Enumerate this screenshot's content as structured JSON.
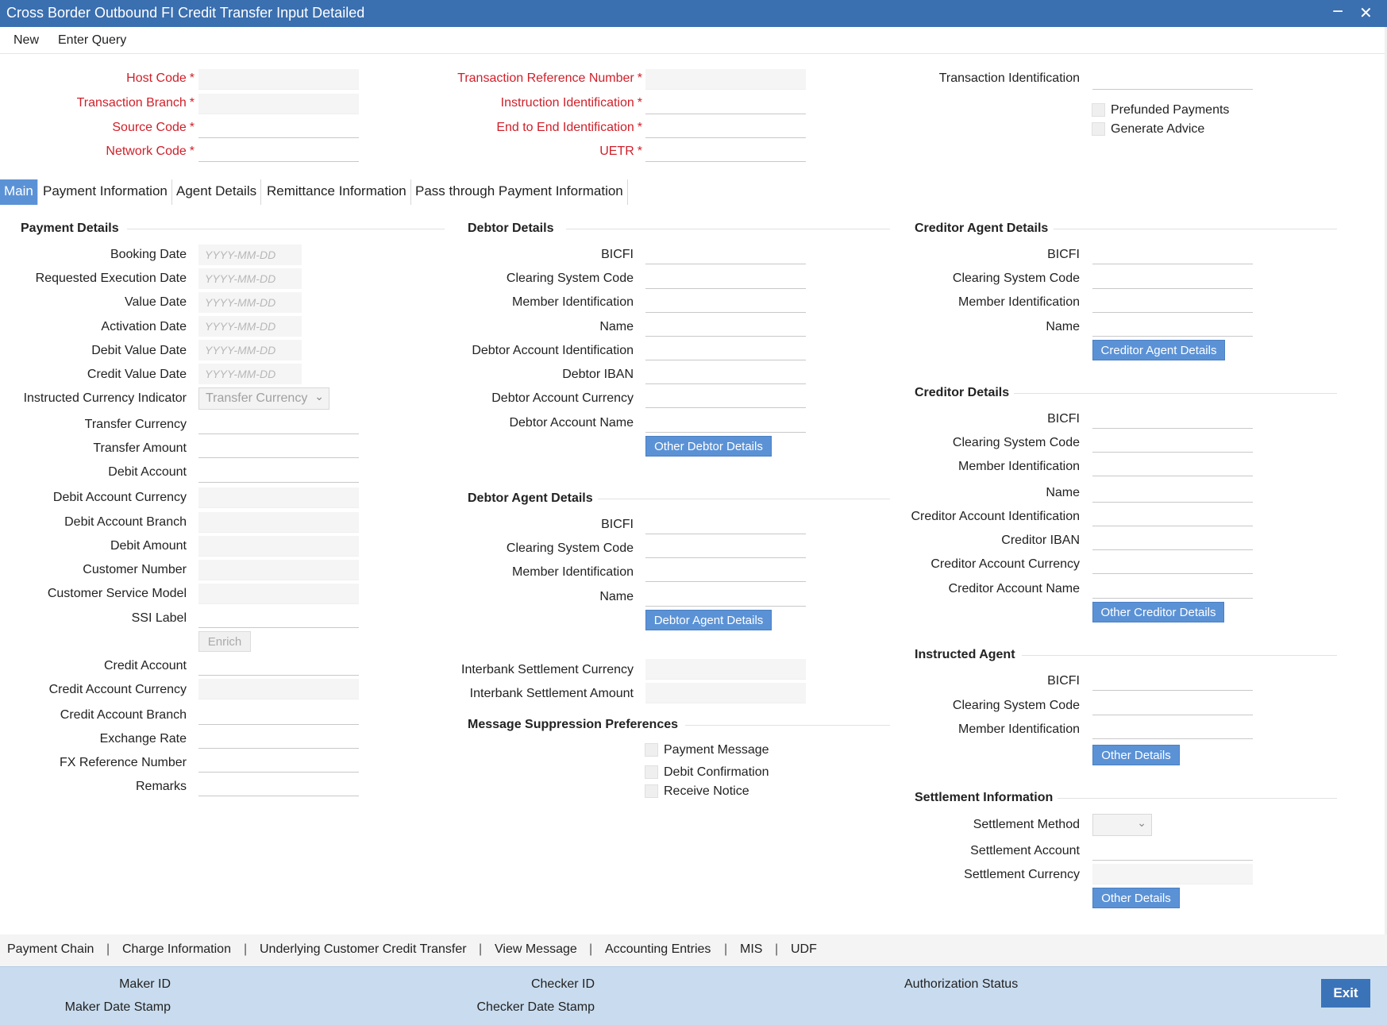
{
  "window": {
    "title": "Cross Border Outbound FI Credit Transfer Input Detailed",
    "minimize_icon": "minimize-icon",
    "close_icon": "close-icon",
    "minimize_glyph": "−",
    "close_glyph": "✕"
  },
  "menu": {
    "new": "New",
    "enter_query": "Enter Query"
  },
  "header": {
    "host_code": "Host Code",
    "transaction_branch": "Transaction Branch",
    "source_code": "Source Code",
    "network_code": "Network Code",
    "transaction_reference_number": "Transaction Reference Number",
    "instruction_identification": "Instruction Identification",
    "end_to_end_identification": "End to End Identification",
    "uetr": "UETR",
    "transaction_identification": "Transaction Identification",
    "prefunded_payments": "Prefunded Payments",
    "generate_advice": "Generate Advice",
    "required_mark": "*"
  },
  "tabs": [
    "Main",
    "Payment Information",
    "Agent Details",
    "Remittance Information",
    "Pass through Payment Information"
  ],
  "payment_details": {
    "title": "Payment Details",
    "booking_date": "Booking Date",
    "requested_execution_date": "Requested Execution Date",
    "value_date": "Value Date",
    "activation_date": "Activation Date",
    "debit_value_date": "Debit Value Date",
    "credit_value_date": "Credit Value Date",
    "date_placeholder": "YYYY-MM-DD",
    "instructed_currency_indicator": "Instructed Currency Indicator",
    "instructed_currency_value": "Transfer Currency",
    "transfer_currency": "Transfer Currency",
    "transfer_amount": "Transfer Amount",
    "debit_account": "Debit Account",
    "debit_account_currency": "Debit Account Currency",
    "debit_account_branch": "Debit Account Branch",
    "debit_amount": "Debit Amount",
    "customer_number": "Customer Number",
    "customer_service_model": "Customer Service Model",
    "ssi_label": "SSI Label",
    "enrich": "Enrich",
    "credit_account": "Credit Account",
    "credit_account_currency": "Credit Account Currency",
    "credit_account_branch": "Credit Account Branch",
    "exchange_rate": "Exchange Rate",
    "fx_reference_number": "FX Reference Number",
    "remarks": "Remarks"
  },
  "debtor_details": {
    "title": "Debtor Details",
    "bicfi": "BICFI",
    "clearing_system_code": "Clearing System Code",
    "member_identification": "Member Identification",
    "name": "Name",
    "debtor_account_identification": "Debtor Account Identification",
    "debtor_iban": "Debtor IBAN",
    "debtor_account_currency": "Debtor Account Currency",
    "debtor_account_name": "Debtor Account Name",
    "button": "Other Debtor Details"
  },
  "debtor_agent_details": {
    "title": "Debtor Agent Details",
    "bicfi": "BICFI",
    "clearing_system_code": "Clearing System Code",
    "member_identification": "Member Identification",
    "name": "Name",
    "button": "Debtor Agent Details"
  },
  "interbank": {
    "currency": "Interbank Settlement Currency",
    "amount": "Interbank Settlement Amount"
  },
  "message_suppression": {
    "title": "Message Suppression Preferences",
    "payment_message": "Payment Message",
    "debit_confirmation": "Debit Confirmation",
    "receive_notice": "Receive Notice"
  },
  "creditor_agent_details": {
    "title": "Creditor Agent Details",
    "bicfi": "BICFI",
    "clearing_system_code": "Clearing System Code",
    "member_identification": "Member Identification",
    "name": "Name",
    "button": "Creditor Agent Details"
  },
  "creditor_details": {
    "title": "Creditor Details",
    "bicfi": "BICFI",
    "clearing_system_code": "Clearing System Code",
    "member_identification": "Member Identification",
    "name": "Name",
    "creditor_account_identification": "Creditor Account Identification",
    "creditor_iban": "Creditor IBAN",
    "creditor_account_currency": "Creditor Account Currency",
    "creditor_account_name": "Creditor Account Name",
    "button": "Other Creditor Details"
  },
  "instructed_agent": {
    "title": "Instructed Agent",
    "bicfi": "BICFI",
    "clearing_system_code": "Clearing System Code",
    "member_identification": "Member Identification",
    "button": "Other Details"
  },
  "settlement_information": {
    "title": "Settlement Information",
    "settlement_method": "Settlement Method",
    "settlement_account": "Settlement Account",
    "settlement_currency": "Settlement Currency",
    "button": "Other Details"
  },
  "bottom_links": [
    "Payment Chain",
    "Charge Information",
    "Underlying Customer Credit Transfer",
    "View Message",
    "Accounting Entries",
    "MIS",
    "UDF"
  ],
  "bottom_separator": "|",
  "footer": {
    "maker_id": "Maker ID",
    "maker_date_stamp": "Maker Date Stamp",
    "checker_id": "Checker ID",
    "checker_date_stamp": "Checker Date Stamp",
    "authorization_status": "Authorization Status",
    "exit": "Exit"
  },
  "colors": {
    "title_bar": "#3a6fb0",
    "required_label": "#d0202a",
    "active_tab": "#5b92d6",
    "button": "#5b92d6",
    "footer": "#c9dcef"
  }
}
